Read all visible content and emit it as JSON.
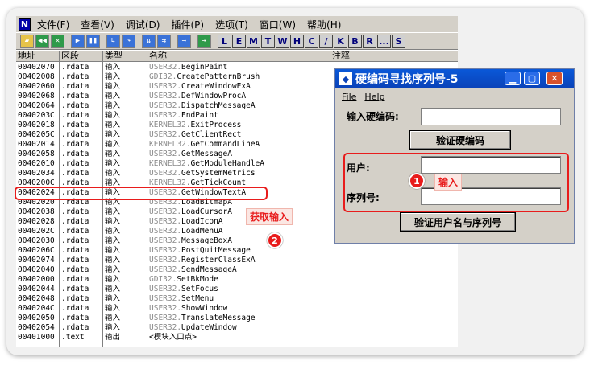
{
  "main_window": {
    "menu": [
      "文件(F)",
      "查看(V)",
      "调试(D)",
      "插件(P)",
      "选项(T)",
      "窗口(W)",
      "帮助(H)"
    ],
    "toolbar_letters": [
      "L",
      "E",
      "M",
      "T",
      "W",
      "H",
      "C",
      "/",
      "K",
      "B",
      "R",
      "...",
      "S"
    ],
    "columns": {
      "addr": "地址",
      "seg": "区段",
      "type": "类型",
      "name": "名称",
      "comment": "注释"
    },
    "rows": [
      {
        "addr": "00402070",
        "seg": ".rdata",
        "type": "输入",
        "module": "USER32.",
        "func": "BeginPaint"
      },
      {
        "addr": "00402008",
        "seg": ".rdata",
        "type": "输入",
        "module": "GDI32.",
        "func": "CreatePatternBrush"
      },
      {
        "addr": "00402060",
        "seg": ".rdata",
        "type": "输入",
        "module": "USER32.",
        "func": "CreateWindowExA"
      },
      {
        "addr": "00402068",
        "seg": ".rdata",
        "type": "输入",
        "module": "USER32.",
        "func": "DefWindowProcA"
      },
      {
        "addr": "00402064",
        "seg": ".rdata",
        "type": "输入",
        "module": "USER32.",
        "func": "DispatchMessageA"
      },
      {
        "addr": "0040203C",
        "seg": ".rdata",
        "type": "输入",
        "module": "USER32.",
        "func": "EndPaint"
      },
      {
        "addr": "00402018",
        "seg": ".rdata",
        "type": "输入",
        "module": "KERNEL32.",
        "func": "ExitProcess"
      },
      {
        "addr": "0040205C",
        "seg": ".rdata",
        "type": "输入",
        "module": "USER32.",
        "func": "GetClientRect"
      },
      {
        "addr": "00402014",
        "seg": ".rdata",
        "type": "输入",
        "module": "KERNEL32.",
        "func": "GetCommandLineA"
      },
      {
        "addr": "00402058",
        "seg": ".rdata",
        "type": "输入",
        "module": "USER32.",
        "func": "GetMessageA"
      },
      {
        "addr": "00402010",
        "seg": ".rdata",
        "type": "输入",
        "module": "KERNEL32.",
        "func": "GetModuleHandleA"
      },
      {
        "addr": "00402034",
        "seg": ".rdata",
        "type": "输入",
        "module": "USER32.",
        "func": "GetSystemMetrics"
      },
      {
        "addr": "0040200C",
        "seg": ".rdata",
        "type": "输入",
        "module": "KERNEL32.",
        "func": "GetTickCount"
      },
      {
        "addr": "00402024",
        "seg": ".rdata",
        "type": "输入",
        "module": "USER32.",
        "func": "GetWindowTextA"
      },
      {
        "addr": "00402020",
        "seg": ".rdata",
        "type": "输入",
        "module": "USER32.",
        "func": "LoadBitmapA"
      },
      {
        "addr": "00402038",
        "seg": ".rdata",
        "type": "输入",
        "module": "USER32.",
        "func": "LoadCursorA"
      },
      {
        "addr": "00402028",
        "seg": ".rdata",
        "type": "输入",
        "module": "USER32.",
        "func": "LoadIconA"
      },
      {
        "addr": "0040202C",
        "seg": ".rdata",
        "type": "输入",
        "module": "USER32.",
        "func": "LoadMenuA"
      },
      {
        "addr": "00402030",
        "seg": ".rdata",
        "type": "输入",
        "module": "USER32.",
        "func": "MessageBoxA"
      },
      {
        "addr": "0040206C",
        "seg": ".rdata",
        "type": "输入",
        "module": "USER32.",
        "func": "PostQuitMessage"
      },
      {
        "addr": "00402074",
        "seg": ".rdata",
        "type": "输入",
        "module": "USER32.",
        "func": "RegisterClassExA"
      },
      {
        "addr": "00402040",
        "seg": ".rdata",
        "type": "输入",
        "module": "USER32.",
        "func": "SendMessageA"
      },
      {
        "addr": "00402000",
        "seg": ".rdata",
        "type": "输入",
        "module": "GDI32.",
        "func": "SetBkMode"
      },
      {
        "addr": "00402044",
        "seg": ".rdata",
        "type": "输入",
        "module": "USER32.",
        "func": "SetFocus"
      },
      {
        "addr": "00402048",
        "seg": ".rdata",
        "type": "输入",
        "module": "USER32.",
        "func": "SetMenu"
      },
      {
        "addr": "0040204C",
        "seg": ".rdata",
        "type": "输入",
        "module": "USER32.",
        "func": "ShowWindow"
      },
      {
        "addr": "00402050",
        "seg": ".rdata",
        "type": "输入",
        "module": "USER32.",
        "func": "TranslateMessage"
      },
      {
        "addr": "00402054",
        "seg": ".rdata",
        "type": "输入",
        "module": "USER32.",
        "func": "UpdateWindow"
      },
      {
        "addr": "00401000",
        "seg": ".text",
        "type": "输出",
        "module": "",
        "func": "<模块入口点>"
      }
    ]
  },
  "dialog": {
    "title": "硬编码寻找序列号-5",
    "menu": [
      "File",
      "Help"
    ],
    "hardcode_label": "输入硬编码:",
    "verify_hardcode_button": "验证硬编码",
    "user_label": "用户:",
    "serial_label": "序列号:",
    "verify_user_button": "验证用户名与序列号"
  },
  "annotations": {
    "badge1": "1",
    "callout1": "输入",
    "badge2": "2",
    "callout2": "获取输入"
  },
  "colors": {
    "accent_red": "#e81c1c",
    "title_blue": "#0a42b8",
    "module_gray": "#8a8a8a"
  }
}
